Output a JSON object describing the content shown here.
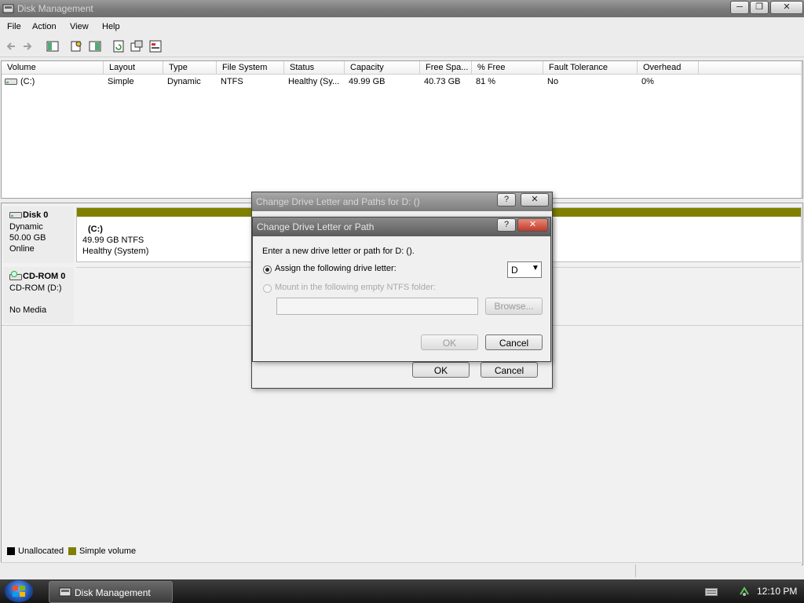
{
  "window": {
    "title": "Disk Management"
  },
  "menu": [
    "File",
    "Action",
    "View",
    "Help"
  ],
  "volume_list": {
    "columns": [
      "Volume",
      "Layout",
      "Type",
      "File System",
      "Status",
      "Capacity",
      "Free Spa...",
      "% Free",
      "Fault Tolerance",
      "Overhead"
    ],
    "rows": [
      {
        "volume": "(C:)",
        "layout": "Simple",
        "type": "Dynamic",
        "file_system": "NTFS",
        "status": "Healthy (Sy...",
        "capacity": "49.99 GB",
        "free_space": "40.73 GB",
        "percent_free": "81 %",
        "fault_tolerance": "No",
        "overhead": "0%"
      }
    ]
  },
  "disks": {
    "disk0": {
      "name": "Disk 0",
      "type": "Dynamic",
      "size": "50.00 GB",
      "state": "Online",
      "partition": {
        "label": "(C:)",
        "size_fs": "49.99 GB NTFS",
        "status": "Healthy (System)"
      }
    },
    "cdrom0": {
      "name": "CD-ROM 0",
      "drive": "CD-ROM (D:)",
      "media": "No Media"
    }
  },
  "legend": {
    "unallocated": "Unallocated",
    "simple_volume": "Simple volume",
    "unallocated_color": "#000000",
    "simple_color": "#808000"
  },
  "back_dialog": {
    "title": "Change Drive Letter and Paths for D: ()",
    "ok": "OK",
    "cancel": "Cancel"
  },
  "front_dialog": {
    "title": "Change Drive Letter or Path",
    "prompt": "Enter a new drive letter or path for D: ().",
    "assign_label": "Assign the following drive letter:",
    "drive_letter": "D",
    "mount_label": "Mount in the following empty NTFS folder:",
    "folder_value": "",
    "browse": "Browse...",
    "ok": "OK",
    "cancel": "Cancel"
  },
  "taskbar": {
    "task": "Disk Management",
    "clock": "12:10 PM"
  }
}
